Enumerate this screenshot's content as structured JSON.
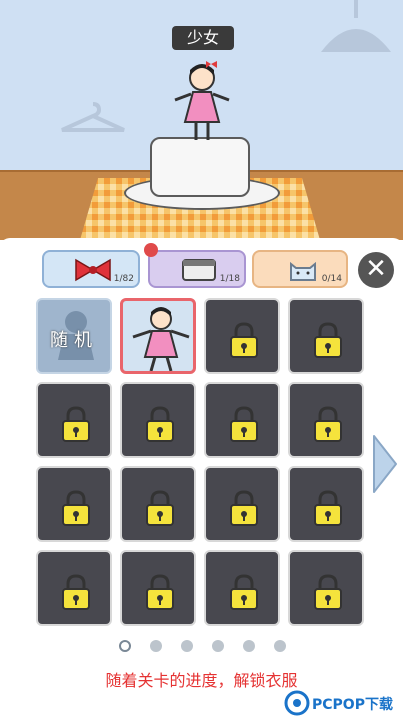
{
  "character_name": "少女",
  "tabs": [
    {
      "name": "bow",
      "count": "1/82"
    },
    {
      "name": "frame",
      "count": "1/18"
    },
    {
      "name": "pet",
      "count": "0/14"
    }
  ],
  "close_glyph": "✕",
  "random_label": "随机",
  "hint": "随着关卡的进度，解锁衣服",
  "watermark": "PCPOP下载",
  "page_dots": 6,
  "active_dot": 0
}
